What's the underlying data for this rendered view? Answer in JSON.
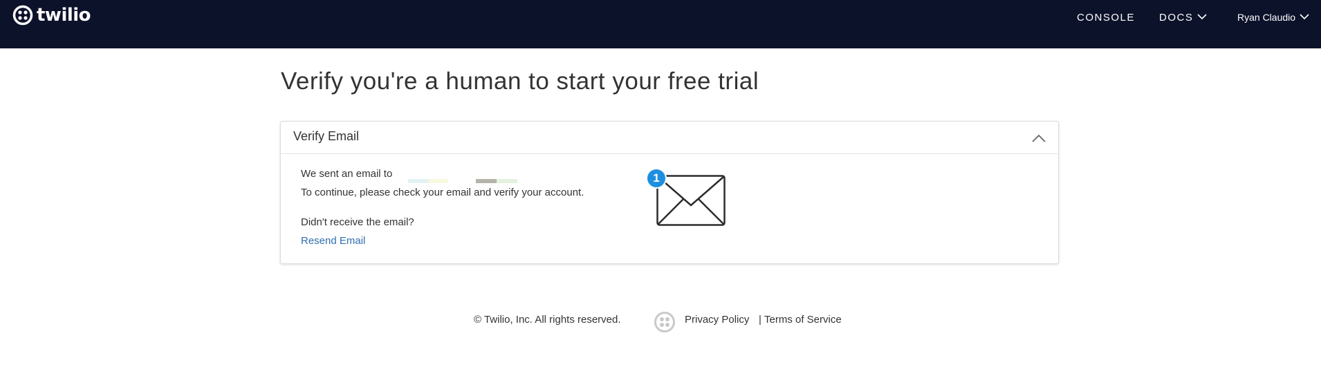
{
  "header": {
    "brand": "twilio",
    "nav": {
      "console": "CONSOLE",
      "docs": "DOCS",
      "user": "Ryan Claudio"
    },
    "icons": [
      "twilio-logo-icon",
      "chevron-down-icon"
    ]
  },
  "page": {
    "title": "Verify you're a human to start your free trial"
  },
  "panel": {
    "title": "Verify Email",
    "sent_text": "We sent an email to",
    "continue_text": "To continue, please check your email and verify your account.",
    "not_received_text": "Didn't receive the email?",
    "resend_link": "Resend Email",
    "badge_count": "1",
    "icons": [
      "chevron-up-icon",
      "envelope-icon"
    ]
  },
  "footer": {
    "copyright": "© Twilio, Inc. All rights reserved.",
    "privacy": "Privacy Policy",
    "separator": "|",
    "terms": "Terms of Service"
  },
  "colors": {
    "header_bg": "#0d122b",
    "link": "#2f6fb0",
    "badge": "#1e8fe0"
  }
}
